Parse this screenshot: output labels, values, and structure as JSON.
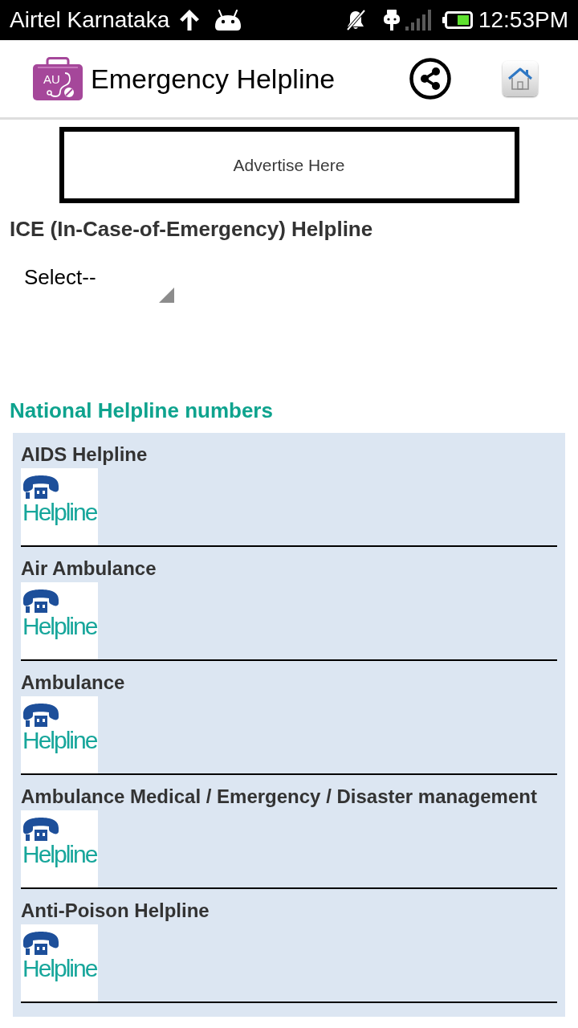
{
  "status_bar": {
    "carrier": "Airtel Karnataka",
    "time": "12:53PM"
  },
  "header": {
    "logo_letters": "AU",
    "title": "Emergency Helpline"
  },
  "banner": {
    "text": "Advertise Here"
  },
  "ice": {
    "heading": "ICE (In-Case-of-Emergency) Helpline",
    "select": {
      "value": "Select--"
    }
  },
  "national": {
    "heading": "National Helpline numbers",
    "items": [
      {
        "name": "AIDS Helpline",
        "logo_text": "Helpline"
      },
      {
        "name": "Air Ambulance",
        "logo_text": "Helpline"
      },
      {
        "name": "Ambulance",
        "logo_text": "Helpline"
      },
      {
        "name": "Ambulance Medical / Emergency / Disaster management",
        "logo_text": "Helpline"
      },
      {
        "name": "Anti-Poison Helpline",
        "logo_text": "Helpline"
      }
    ]
  }
}
